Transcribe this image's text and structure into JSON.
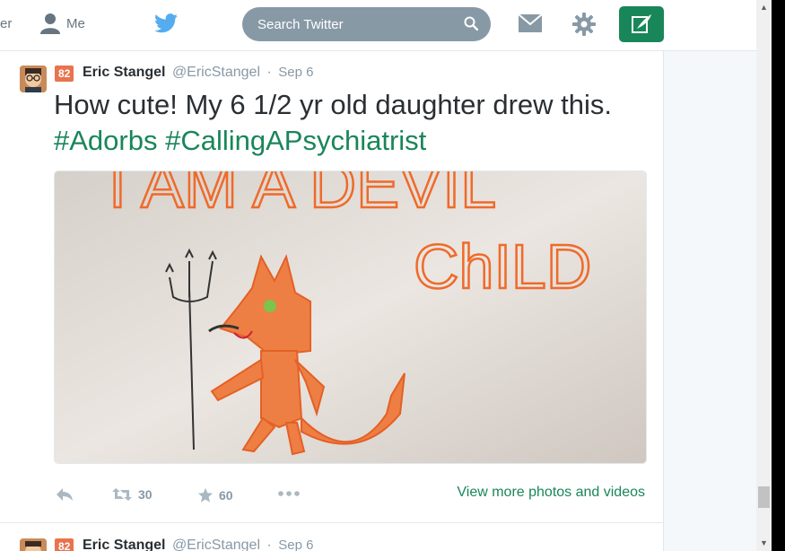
{
  "nav": {
    "cut_label": "er",
    "me_label": "Me",
    "search_placeholder": "Search Twitter",
    "icons": [
      "person-icon",
      "twitter-bird-icon",
      "search-icon",
      "mail-icon",
      "gear-icon",
      "compose-icon"
    ]
  },
  "colors": {
    "accent": "#19865a",
    "search_bg": "#8899a6",
    "badge": "#e8734e"
  },
  "tweets": [
    {
      "badge": "82",
      "fullname": "Eric Stangel",
      "username": "@EricStangel",
      "time": "Sep 6",
      "text_before": "How cute! My 6 1/2 yr old daughter drew this.",
      "hashtags": [
        "#Adorbs",
        "#CallingAPsychiatrist"
      ],
      "retweets": "30",
      "favorites": "60",
      "more_link": "View more photos and videos"
    },
    {
      "badge": "82",
      "fullname": "Eric Stangel",
      "username": "@EricStangel",
      "time": "Sep 6"
    }
  ],
  "drawing_text": {
    "line1": "I AM A DEVIL",
    "line2": "ChILD"
  }
}
